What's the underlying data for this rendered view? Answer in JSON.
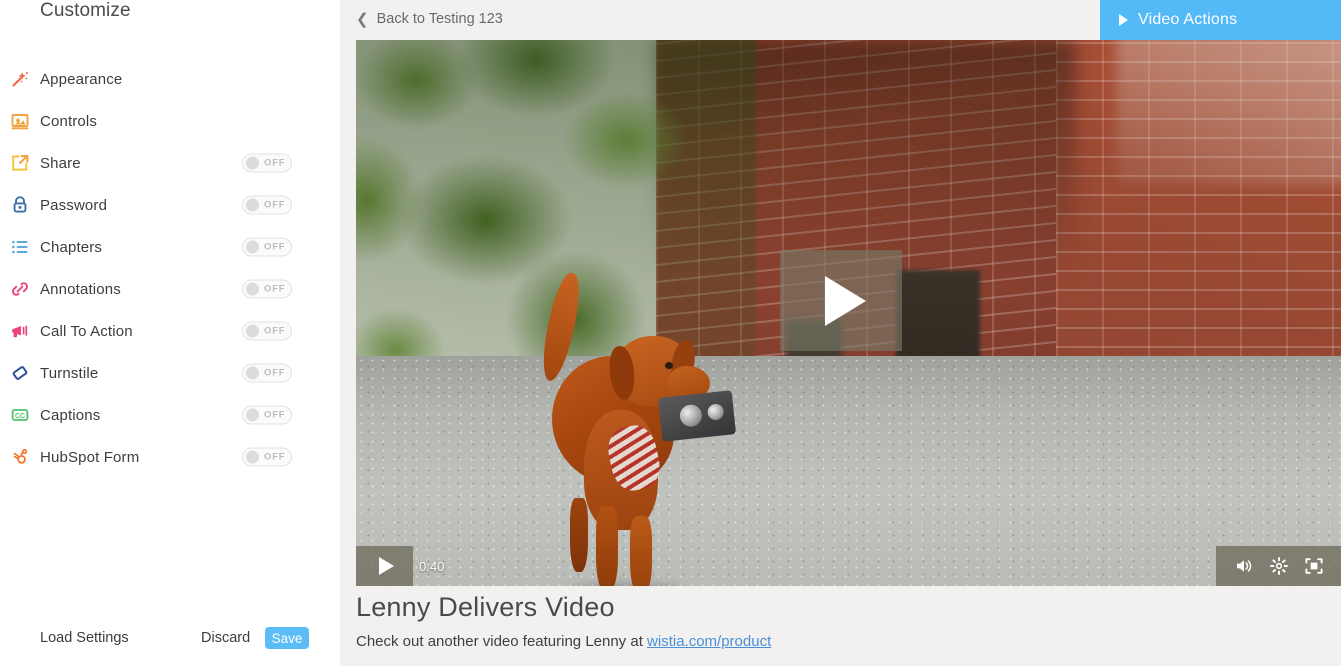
{
  "sidebar": {
    "title": "Customize",
    "items": [
      {
        "label": "Appearance",
        "icon": "magic-wand-icon",
        "has_toggle": false
      },
      {
        "label": "Controls",
        "icon": "player-controls-icon",
        "has_toggle": false
      },
      {
        "label": "Share",
        "icon": "share-icon",
        "has_toggle": true,
        "toggle_state": "OFF"
      },
      {
        "label": "Password",
        "icon": "lock-icon",
        "has_toggle": true,
        "toggle_state": "OFF"
      },
      {
        "label": "Chapters",
        "icon": "list-icon",
        "has_toggle": true,
        "toggle_state": "OFF"
      },
      {
        "label": "Annotations",
        "icon": "link-icon",
        "has_toggle": true,
        "toggle_state": "OFF"
      },
      {
        "label": "Call To Action",
        "icon": "megaphone-icon",
        "has_toggle": true,
        "toggle_state": "OFF"
      },
      {
        "label": "Turnstile",
        "icon": "ticket-icon",
        "has_toggle": true,
        "toggle_state": "OFF"
      },
      {
        "label": "Captions",
        "icon": "closed-captions-icon",
        "has_toggle": true,
        "toggle_state": "OFF"
      },
      {
        "label": "HubSpot Form",
        "icon": "hubspot-icon",
        "has_toggle": true,
        "toggle_state": "OFF"
      }
    ],
    "footer": {
      "load_settings_label": "Load Settings",
      "discard_label": "Discard",
      "save_label": "Save"
    }
  },
  "topbar": {
    "back_label": "Back to Testing 123",
    "back_icon": "chevron-left-icon",
    "video_actions_label": "Video Actions",
    "video_actions_icon": "caret-right-icon"
  },
  "player": {
    "time": "0:40",
    "play_icon": "play-icon",
    "volume_icon": "volume-icon",
    "settings_icon": "gear-icon",
    "fullscreen_icon": "fullscreen-icon"
  },
  "video_meta": {
    "title": "Lenny Delivers Video",
    "description_prefix": "Check out another video featuring Lenny at ",
    "description_link": "wistia.com/product"
  },
  "colors": {
    "accent_blue": "#54b9f7",
    "save_blue": "#5cbcf6",
    "main_bg": "#f2f1ef",
    "sidebar_bg": "#ffffff",
    "link_blue": "#4a90d9"
  }
}
